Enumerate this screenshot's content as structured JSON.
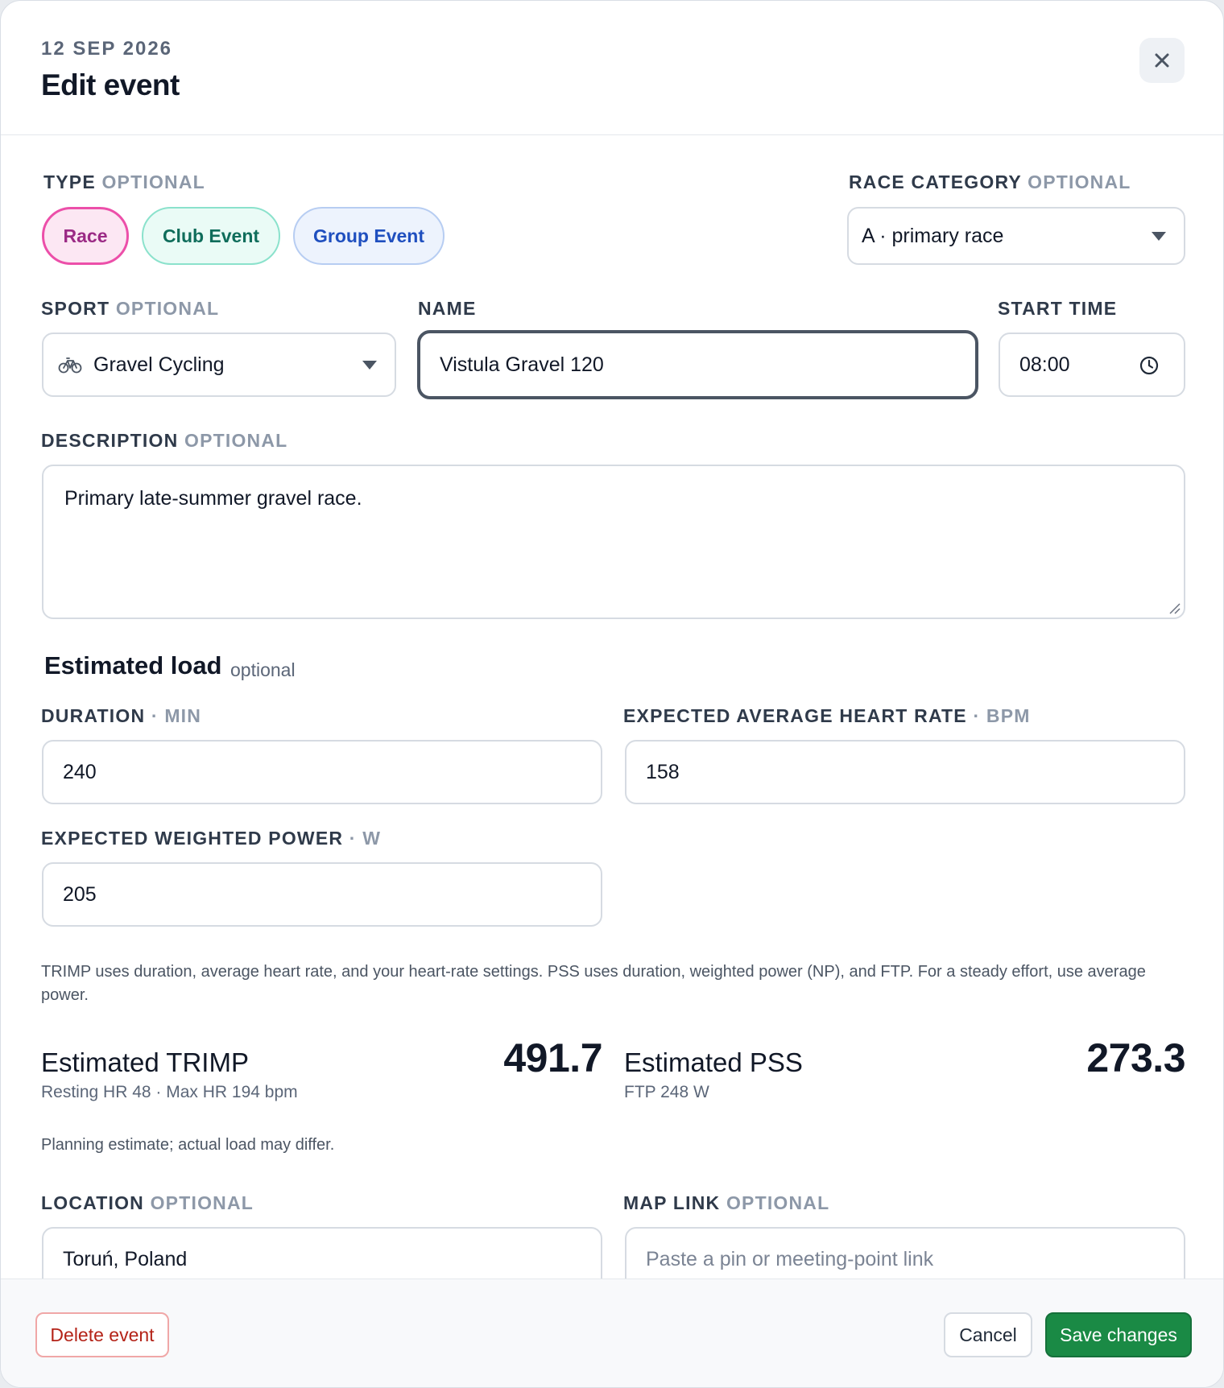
{
  "header": {
    "date": "12 SEP 2026",
    "title": "Edit event"
  },
  "type": {
    "label": "TYPE",
    "optional": "OPTIONAL",
    "options": [
      "Race",
      "Club Event",
      "Group Event"
    ],
    "selected": "Race"
  },
  "race_category": {
    "label": "RACE CATEGORY",
    "optional": "OPTIONAL",
    "value": "A · primary race"
  },
  "sport": {
    "label": "SPORT",
    "optional": "OPTIONAL",
    "value": "Gravel Cycling",
    "icon": "bicycle-icon"
  },
  "name": {
    "label": "NAME",
    "value": "Vistula Gravel 120"
  },
  "start_time": {
    "label": "START TIME",
    "value": "08:00",
    "icon": "clock-icon"
  },
  "description": {
    "label": "DESCRIPTION",
    "optional": "OPTIONAL",
    "value": "Primary late-summer gravel race."
  },
  "estimated_load": {
    "title": "Estimated load",
    "optional": "optional",
    "duration": {
      "label": "DURATION",
      "unit": "· MIN",
      "value": "240"
    },
    "avg_hr": {
      "label": "EXPECTED AVERAGE HEART RATE",
      "unit": "· BPM",
      "value": "158"
    },
    "weighted_power": {
      "label": "EXPECTED WEIGHTED POWER",
      "unit": "· W",
      "value": "205"
    },
    "help_text": "TRIMP uses duration, average heart rate, and your heart-rate settings. PSS uses duration, weighted power (NP), and FTP. For a steady effort, use average power.",
    "trimp": {
      "title": "Estimated TRIMP",
      "sub": "Resting HR 48 · Max HR 194 bpm",
      "value": "491.7"
    },
    "pss": {
      "title": "Estimated PSS",
      "sub": "FTP 248 W",
      "value": "273.3"
    },
    "note": "Planning estimate; actual load may differ."
  },
  "location": {
    "label": "LOCATION",
    "optional": "OPTIONAL",
    "value": "Toruń, Poland"
  },
  "map_link": {
    "label": "MAP LINK",
    "optional": "OPTIONAL",
    "placeholder": "Paste a pin or meeting-point link"
  },
  "footer": {
    "delete": "Delete event",
    "cancel": "Cancel",
    "save": "Save changes"
  },
  "colors": {
    "race_accent": "#ec4fa9",
    "club_accent": "#0f6d5b",
    "group_accent": "#1f4fbf",
    "save_button": "#1a8a45",
    "delete_text": "#b42318"
  }
}
